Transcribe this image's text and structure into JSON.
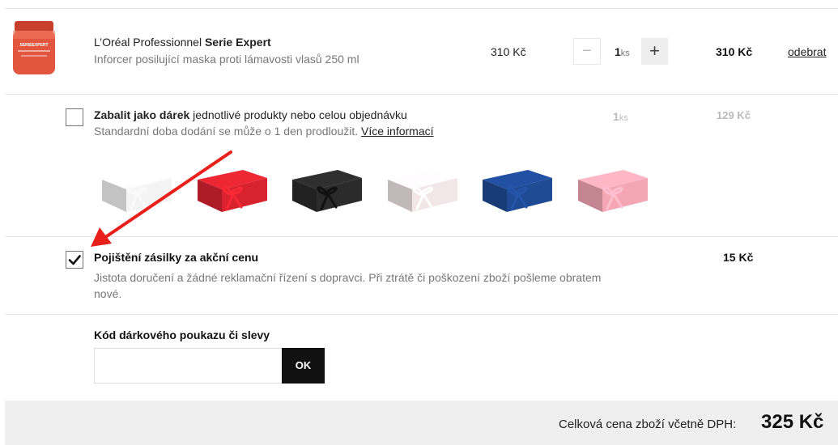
{
  "product": {
    "brand": "L’Oréal Professionnel",
    "line": "Serie Expert",
    "description": "Inforcer posilující maska proti lámavosti vlasů 250 ml",
    "thumb_label": "SERIEEXPERT",
    "unit_price": "310 Kč",
    "qty_minus": "−",
    "qty": "1",
    "qty_unit": "ks",
    "qty_plus": "+",
    "total": "310 Kč",
    "remove": "odebrat"
  },
  "gift_wrap": {
    "checked": false,
    "title_bold": "Zabalit jako dárek",
    "title_rest": " jednotlivé produkty nebo celou objednávku",
    "subtitle": "Standardní doba dodání se může o 1 den prodloužit. ",
    "more_info": "Více informací",
    "qty": "1",
    "qty_unit": "ks",
    "price": "129 Kč",
    "box_colors": [
      "#f4f4f4",
      "#d8232f",
      "#2b2b2b",
      "#f1e6e8",
      "#1f4a94",
      "#f4a6b4"
    ],
    "box_names": [
      "white-gift-box",
      "red-gift-box",
      "black-gift-box",
      "pearl-gift-box",
      "blue-gift-box",
      "pink-gift-box"
    ]
  },
  "insurance": {
    "checked": true,
    "check_mark": "✔",
    "title": "Pojištění zásilky za akční cenu",
    "description": "Jistota doručení a žádné reklamační řízení s dopravci. Při ztrátě či poškození zboží pošleme obratem nové.",
    "price": "15 Kč"
  },
  "coupon": {
    "label": "Kód dárkového poukazu či slevy",
    "input_value": "",
    "button": "OK"
  },
  "totals": {
    "label": "Celková cena zboží včetně DPH:",
    "value": "325 Kč"
  },
  "colors": {
    "annotation_arrow": "#e8201c",
    "thumb_jar": "#e2563f"
  }
}
